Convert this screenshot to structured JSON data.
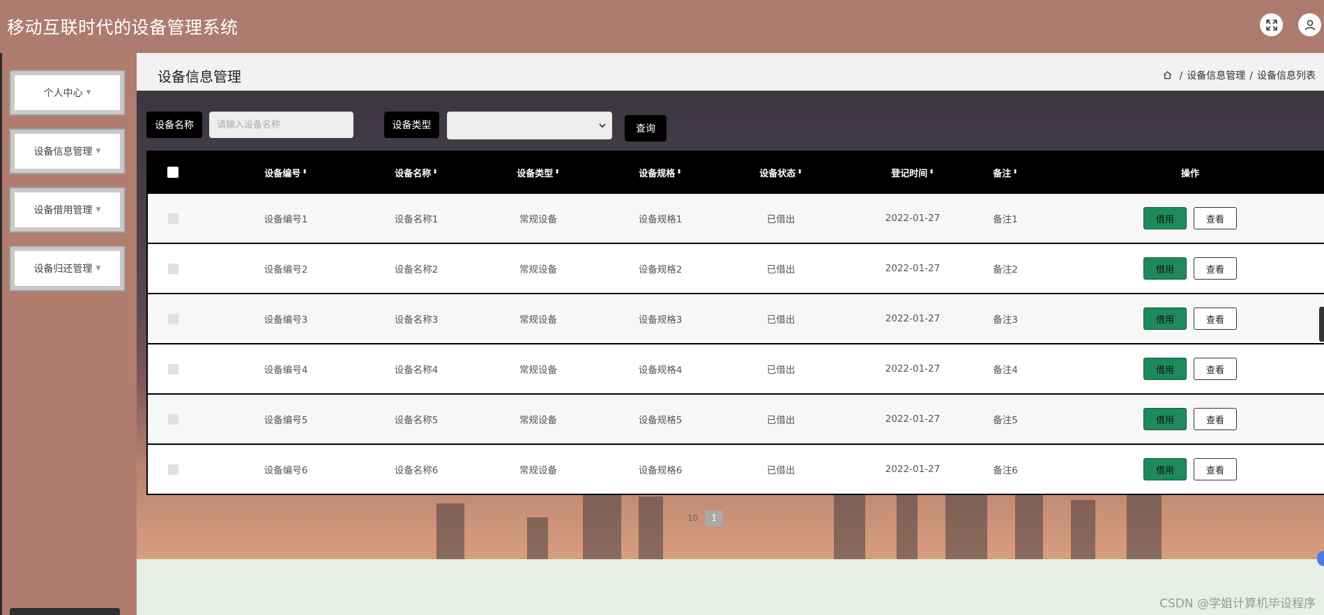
{
  "app": {
    "title": "移动互联时代的设备管理系统",
    "icons": [
      "expand-icon",
      "user-icon"
    ]
  },
  "sidebar": {
    "items": [
      {
        "label": "个人中心"
      },
      {
        "label": "设备信息管理"
      },
      {
        "label": "设备借用管理"
      },
      {
        "label": "设备归还管理"
      }
    ]
  },
  "header": {
    "page_title": "设备信息管理",
    "breadcrumb": [
      "设备信息管理",
      "设备信息列表"
    ]
  },
  "search": {
    "name_label": "设备名称",
    "name_placeholder": "请输入设备名称",
    "name_value": "",
    "type_label": "设备类型",
    "type_value": "",
    "query_label": "查询"
  },
  "table": {
    "columns": [
      "设备编号",
      "设备名称",
      "设备类型",
      "设备规格",
      "设备状态",
      "登记时间",
      "备注",
      "操作"
    ],
    "rows": [
      {
        "id": "设备编号1",
        "name": "设备名称1",
        "type": "常规设备",
        "spec": "设备规格1",
        "status": "已借出",
        "date": "2022-01-27",
        "note": "备注1"
      },
      {
        "id": "设备编号2",
        "name": "设备名称2",
        "type": "常规设备",
        "spec": "设备规格2",
        "status": "已借出",
        "date": "2022-01-27",
        "note": "备注2"
      },
      {
        "id": "设备编号3",
        "name": "设备名称3",
        "type": "常规设备",
        "spec": "设备规格3",
        "status": "已借出",
        "date": "2022-01-27",
        "note": "备注3"
      },
      {
        "id": "设备编号4",
        "name": "设备名称4",
        "type": "常规设备",
        "spec": "设备规格4",
        "status": "已借出",
        "date": "2022-01-27",
        "note": "备注4"
      },
      {
        "id": "设备编号5",
        "name": "设备名称5",
        "type": "常规设备",
        "spec": "设备规格5",
        "status": "已借出",
        "date": "2022-01-27",
        "note": "备注5"
      },
      {
        "id": "设备编号6",
        "name": "设备名称6",
        "type": "常规设备",
        "spec": "设备规格6",
        "status": "已借出",
        "date": "2022-01-27",
        "note": "备注6"
      }
    ],
    "action_borrow": "借用",
    "action_view": "查看"
  },
  "pagination": {
    "page_size": "10",
    "current_page": "1"
  },
  "watermark": "CSDN @学姐计算机毕设程序",
  "colors": {
    "topbar": "#ad7c6e",
    "sidebar": "#b17d6f",
    "borrow_button": "#1e8a5c",
    "table_header": "#000000"
  }
}
